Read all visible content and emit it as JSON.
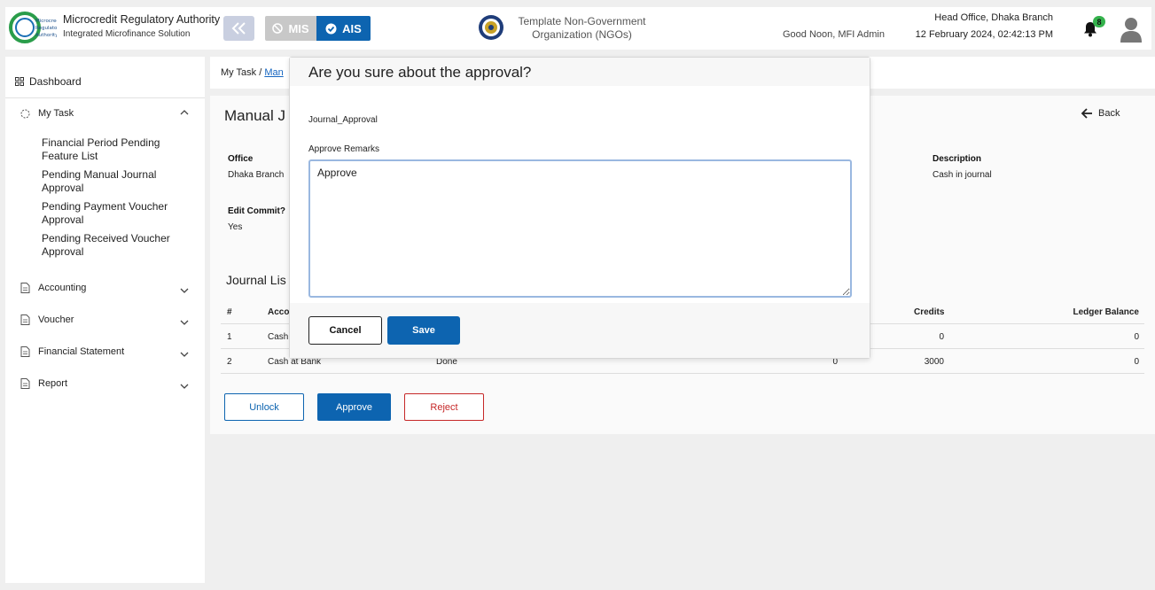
{
  "header": {
    "brand_title": "Microcredit Regulatory Authority",
    "brand_subtitle": "Integrated Microfinance Solution",
    "logo_text": "Microcredit Regulatory Authority",
    "mis_label": "MIS",
    "ais_label": "AIS",
    "org_name": "Template Non-Government Organization (NGOs)",
    "greeting": "Good Noon, MFI Admin",
    "office": "Head Office, Dhaka Branch",
    "datetime": "12 February 2024, 02:42:13 PM",
    "notification_count": "8",
    "accent_color": "#0d64b0"
  },
  "sidebar": {
    "dashboard": "Dashboard",
    "my_task": "My Task",
    "my_task_items": [
      "Financial Period Pending Feature List",
      "Pending Manual Journal Approval",
      "Pending Payment Voucher Approval",
      "Pending Received Voucher Approval"
    ],
    "accounting": "Accounting",
    "voucher": "Voucher",
    "financial_statement": "Financial Statement",
    "report": "Report"
  },
  "main": {
    "breadcrumb_root": "My Task",
    "breadcrumb_sep": "/",
    "breadcrumb_link": "Man",
    "page_title": "Manual J",
    "back_label": "Back",
    "fields": {
      "office_label": "Office",
      "office_value": "Dhaka Branch",
      "description_label": "Description",
      "description_value": "Cash in journal",
      "edit_commit_label": "Edit Commit?",
      "edit_commit_value": "Yes"
    },
    "list_title": "Journal Lis",
    "table": {
      "headers": [
        "#",
        "Acco",
        "Credits",
        "Ledger Balance"
      ],
      "rows": [
        {
          "num": "1",
          "account": "Cash",
          "status": "",
          "debit": "",
          "credit": "0",
          "balance": "0"
        },
        {
          "num": "2",
          "account": "Cash at Bank",
          "status": "Done",
          "debit": "0",
          "credit": "3000",
          "balance": "0"
        }
      ]
    },
    "unlock_label": "Unlock",
    "approve_label": "Approve",
    "reject_label": "Reject"
  },
  "modal": {
    "title": "Are you sure about the approval?",
    "subtitle": "Journal_Approval",
    "remarks_label": "Approve Remarks",
    "remarks_value": "Approve",
    "cancel_label": "Cancel",
    "save_label": "Save"
  }
}
